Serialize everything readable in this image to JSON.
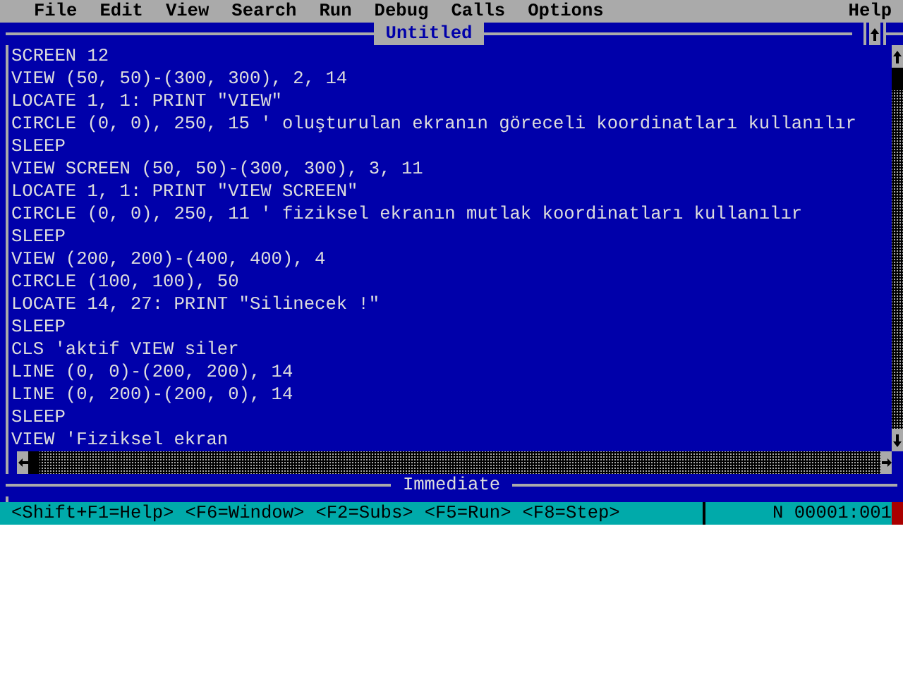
{
  "menu": [
    {
      "label": "File"
    },
    {
      "label": "Edit"
    },
    {
      "label": "View"
    },
    {
      "label": "Search"
    },
    {
      "label": "Run"
    },
    {
      "label": "Debug"
    },
    {
      "label": "Calls"
    },
    {
      "label": "Options"
    },
    {
      "label": "Help",
      "kind": "right"
    }
  ],
  "editor": {
    "title": "Untitled",
    "lines": [
      "SCREEN 12",
      "VIEW (50, 50)-(300, 300), 2, 14",
      "LOCATE 1, 1: PRINT \"VIEW\"",
      "CIRCLE (0, 0), 250, 15 ' oluşturulan ekranın göreceli koordinatları kullanılır",
      "SLEEP",
      "VIEW SCREEN (50, 50)-(300, 300), 3, 11",
      "LOCATE 1, 1: PRINT \"VIEW SCREEN\"",
      "CIRCLE (0, 0), 250, 11 ' fiziksel ekranın mutlak koordinatları kullanılır",
      "SLEEP",
      "VIEW (200, 200)-(400, 400), 4",
      "CIRCLE (100, 100), 50",
      "LOCATE 14, 27: PRINT \"Silinecek !\"",
      "SLEEP",
      "CLS 'aktif VIEW siler",
      "LINE (0, 0)-(200, 200), 14",
      "LINE (0, 200)-(200, 0), 14",
      "SLEEP",
      "VIEW 'Fiziksel ekran"
    ]
  },
  "immediate": {
    "title": "Immediate"
  },
  "status_bar": {
    "hints": [
      "<Shift+F1=Help>",
      "<F6=Window>",
      "<F2=Subs>",
      "<F5=Run>",
      "<F8=Step>"
    ],
    "position": "N 00001:001"
  }
}
